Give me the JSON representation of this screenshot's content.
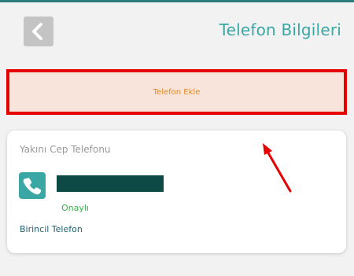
{
  "header": {
    "title": "Telefon Bilgileri",
    "back_icon": "chevron-left-icon"
  },
  "actions": {
    "add_phone_label": "Telefon Ekle"
  },
  "phone_card": {
    "title": "Yakını Cep Telefonu",
    "icon": "phone-icon",
    "number": "",
    "status": "Onaylı",
    "primary_label": "Birincil Telefon"
  },
  "colors": {
    "accent": "#3ba7a4",
    "highlight_border": "#e60000",
    "add_phone_bg": "#f9e4dc",
    "add_phone_text": "#e08a1e",
    "status_green": "#37b24d",
    "redaction": "#0d4a45"
  }
}
